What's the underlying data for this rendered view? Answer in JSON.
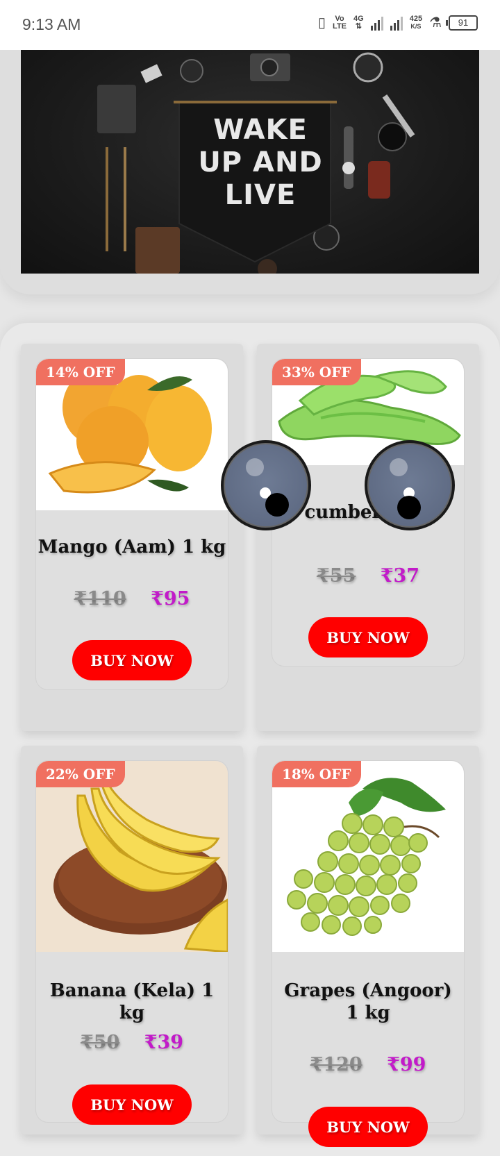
{
  "status_bar": {
    "time": "9:13 AM",
    "vo_lte_top": "Vo",
    "vo_lte_bottom": "LTE",
    "network": "4G",
    "speed_value": "425",
    "speed_unit": "K/S",
    "battery": "91"
  },
  "banner": {
    "line1": "WAKE",
    "line2": "UP AND",
    "line3": "LIVE"
  },
  "products": [
    {
      "discount": "14% OFF",
      "name": "Mango (Aam) 1 kg",
      "old_price": "₹110",
      "new_price": "₹95",
      "button": "BUY NOW"
    },
    {
      "discount": "33% OFF",
      "name": "cumber 1 kg",
      "old_price": "₹55",
      "new_price": "₹37",
      "button": "BUY NOW"
    },
    {
      "discount": "22% OFF",
      "name": "Banana (Kela) 1 kg",
      "old_price": "₹50",
      "new_price": "₹39",
      "button": "BUY NOW"
    },
    {
      "discount": "18% OFF",
      "name": "Grapes (Angoor) 1 kg",
      "old_price": "₹120",
      "new_price": "₹99",
      "button": "BUY NOW"
    }
  ],
  "colors": {
    "buy_button": "#ff0000",
    "badge": "#f07060",
    "new_price": "#c21ac9",
    "old_price": "#8a8a8a"
  }
}
